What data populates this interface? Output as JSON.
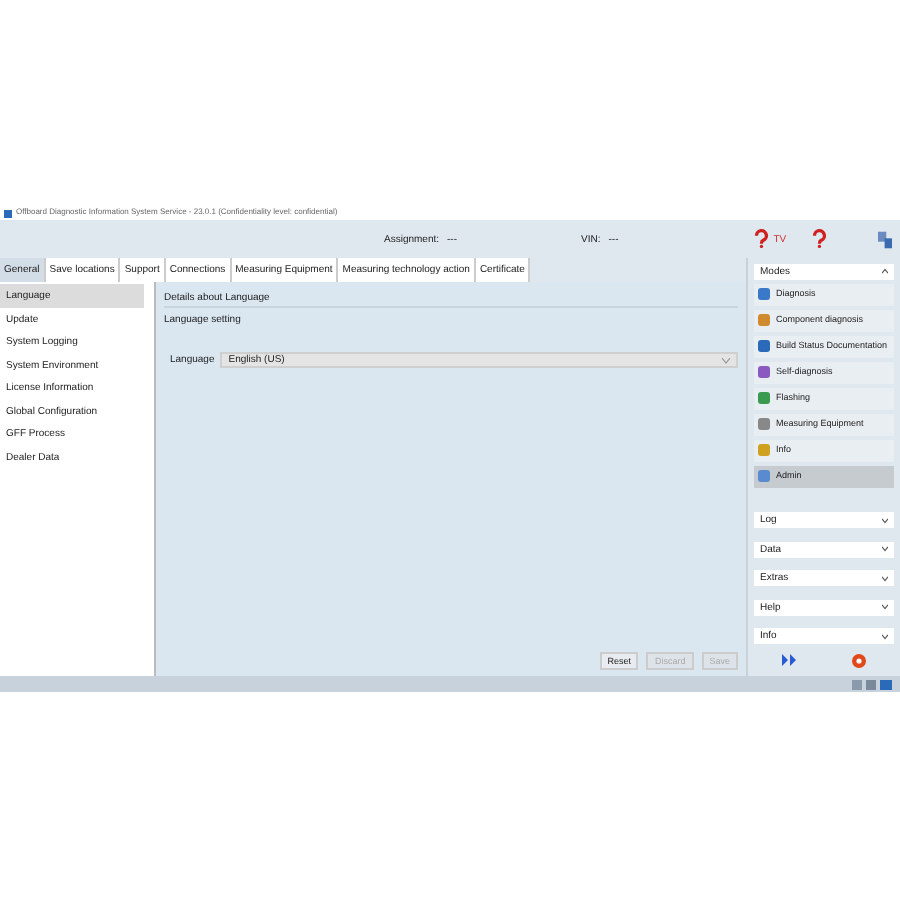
{
  "window": {
    "title": "Offboard Diagnostic Information System Service - 23.0.1 (Confidentiality level: confidential)"
  },
  "header": {
    "assignment_label": "Assignment:",
    "assignment_value": "---",
    "vin_label": "VIN:",
    "vin_value": "---",
    "badge": "TV"
  },
  "tabs": [
    {
      "label": "General",
      "selected": true
    },
    {
      "label": "Save locations",
      "selected": false
    },
    {
      "label": "Support",
      "selected": false
    },
    {
      "label": "Connections",
      "selected": false
    },
    {
      "label": "Measuring Equipment",
      "selected": false
    },
    {
      "label": "Measuring technology action",
      "selected": false
    },
    {
      "label": "Certificate",
      "selected": false
    }
  ],
  "sidebar": {
    "items": [
      {
        "label": "Language",
        "selected": true
      },
      {
        "label": "Update",
        "selected": false
      },
      {
        "label": "System Logging",
        "selected": false
      },
      {
        "label": "System Environment",
        "selected": false
      },
      {
        "label": "License Information",
        "selected": false
      },
      {
        "label": "Global Configuration",
        "selected": false
      },
      {
        "label": "GFF Process",
        "selected": false
      },
      {
        "label": "Dealer Data",
        "selected": false
      }
    ]
  },
  "details": {
    "title": "Details about Language",
    "section": "Language setting",
    "field_label": "Language",
    "field_value": "English (US)"
  },
  "buttons": [
    {
      "label": "Reset",
      "disabled": false
    },
    {
      "label": "Discard",
      "disabled": true
    },
    {
      "label": "Save",
      "disabled": true
    }
  ],
  "modes": {
    "title": "Modes",
    "items": [
      {
        "label": "Diagnosis",
        "selected": false,
        "color": "#3a78c8"
      },
      {
        "label": "Component diagnosis",
        "selected": false,
        "color": "#d08a30"
      },
      {
        "label": "Build Status Documentation",
        "selected": false,
        "color": "#2a6ab8"
      },
      {
        "label": "Self-diagnosis",
        "selected": false,
        "color": "#8a5ac0"
      },
      {
        "label": "Flashing",
        "selected": false,
        "color": "#3a9a50"
      },
      {
        "label": "Measuring Equipment",
        "selected": false,
        "color": "#888888"
      },
      {
        "label": "Info",
        "selected": false,
        "color": "#d0a020"
      },
      {
        "label": "Admin",
        "selected": true,
        "color": "#5a8ad0"
      }
    ]
  },
  "panels": [
    {
      "label": "Log"
    },
    {
      "label": "Data"
    },
    {
      "label": "Extras"
    },
    {
      "label": "Help"
    },
    {
      "label": "Info"
    }
  ]
}
